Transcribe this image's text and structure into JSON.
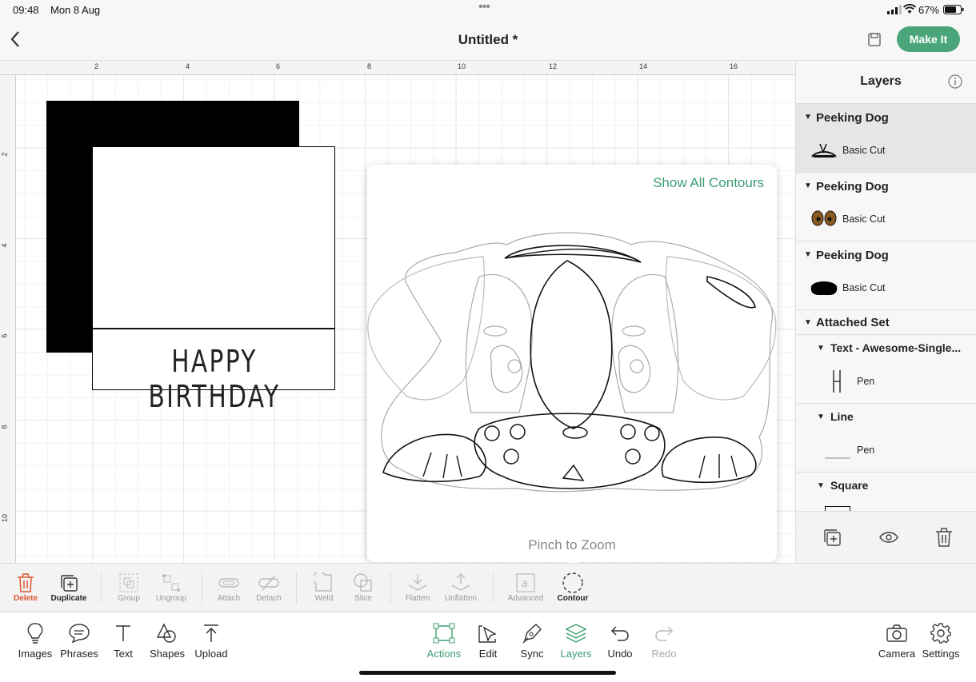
{
  "status_bar": {
    "time": "09:48",
    "date": "Mon 8 Aug",
    "battery": "67%",
    "dots": "•••"
  },
  "header": {
    "title": "Untitled *",
    "make_it_label": "Make It"
  },
  "ruler": {
    "top_ticks": [
      "2",
      "4",
      "6",
      "8",
      "10",
      "12",
      "14",
      "16"
    ],
    "left_ticks": [
      "2",
      "4",
      "6",
      "8",
      "10"
    ]
  },
  "canvas": {
    "card_text": "HAPPY BIRTHDAY"
  },
  "contour_popup": {
    "show_all_label": "Show All Contours",
    "hint": "Pinch to Zoom"
  },
  "layers_panel": {
    "title": "Layers",
    "groups": [
      {
        "name": "Peeking Dog",
        "op": "Basic Cut"
      },
      {
        "name": "Peeking Dog",
        "op": "Basic Cut"
      },
      {
        "name": "Peeking Dog",
        "op": "Basic Cut"
      },
      {
        "name": "Attached Set"
      }
    ],
    "attached_children": [
      {
        "name": "Text - Awesome-Single...",
        "op": "Pen"
      },
      {
        "name": "Line",
        "op": "Pen"
      },
      {
        "name": "Square"
      }
    ]
  },
  "edit_toolbar": {
    "tools": [
      "Delete",
      "Duplicate",
      "Group",
      "Ungroup",
      "Attach",
      "Detach",
      "Weld",
      "Slice",
      "Flatten",
      "Unflatten",
      "Advanced",
      "Contour"
    ]
  },
  "bottom_bar": {
    "left": [
      "Images",
      "Phrases",
      "Text",
      "Shapes",
      "Upload"
    ],
    "center": [
      "Actions",
      "Edit",
      "Sync",
      "Layers",
      "Undo",
      "Redo"
    ],
    "right": [
      "Camera",
      "Settings"
    ]
  },
  "colors": {
    "accent": "#4aa57a",
    "delete": "#d9552f"
  }
}
